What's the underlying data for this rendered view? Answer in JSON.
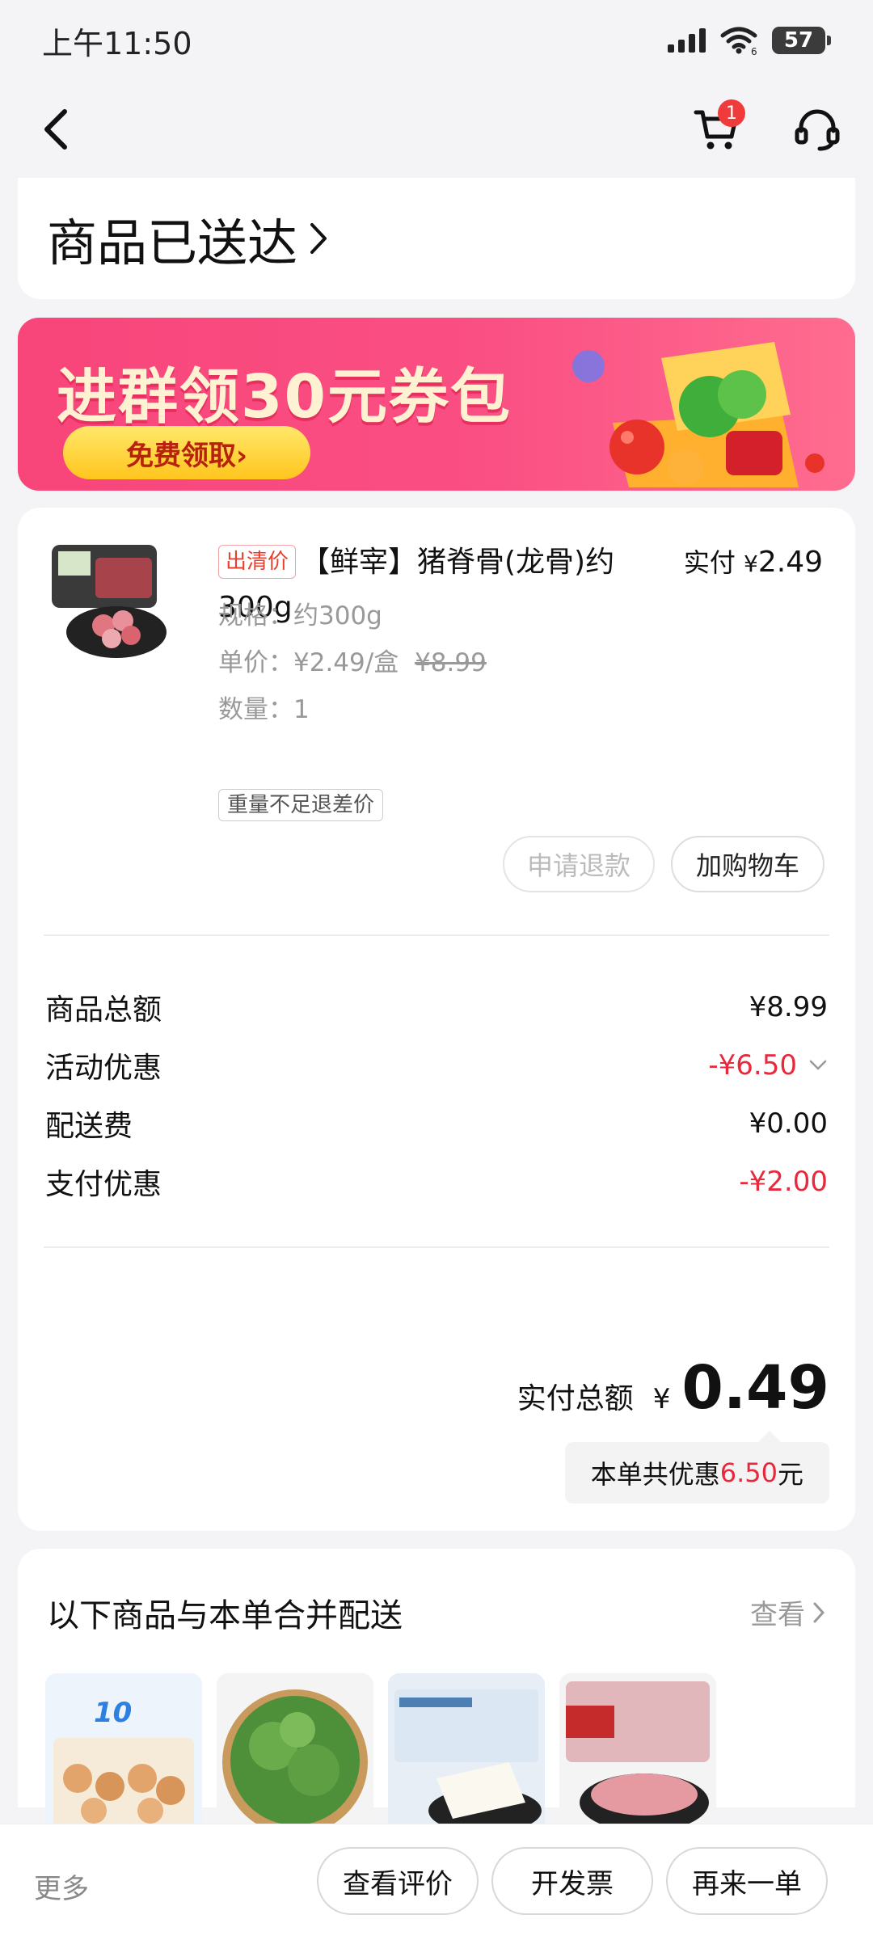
{
  "status_bar": {
    "time": "上午11:50",
    "battery": "57",
    "network_label": "6"
  },
  "nav": {
    "back_icon": "chevron-left-icon",
    "cart_icon": "cart-icon",
    "cart_badge": "1",
    "service_icon": "headset-icon"
  },
  "header": {
    "status_title": "商品已送达"
  },
  "banner": {
    "title": "进群领30元券包",
    "button_label": "免费领取›"
  },
  "product": {
    "tag": "出清价",
    "name": "【鲜宰】猪脊骨(龙骨)约300g",
    "pay_label": "实付",
    "pay_currency": "¥",
    "pay_amount": "2.49",
    "spec": "规格：约300g",
    "unit_price": "单价：¥2.49/盒",
    "original_price": "¥8.99",
    "quantity": "数量：1",
    "weight_tag": "重量不足退差价",
    "refund_button": "申请退款",
    "add_cart_button": "加购物车"
  },
  "fees": [
    {
      "label": "商品总额",
      "value": "¥8.99",
      "negative": false
    },
    {
      "label": "活动优惠",
      "value": "-¥6.50",
      "negative": true,
      "expandable": true
    },
    {
      "label": "配送费",
      "value": "¥0.00",
      "negative": false
    },
    {
      "label": "支付优惠",
      "value": "-¥2.00",
      "negative": true
    }
  ],
  "total": {
    "label": "实付总额",
    "currency": "¥",
    "amount": "0.49",
    "saving_prefix": "本单共优惠",
    "saving_amount": "6.50",
    "saving_suffix": "元"
  },
  "merge": {
    "title": "以下商品与本单合并配送",
    "view_label": "查看",
    "thumb_badge": "10"
  },
  "bottom_bar": {
    "more_label": "更多",
    "review_button": "查看评价",
    "invoice_button": "开发票",
    "reorder_button": "再来一单"
  },
  "colors": {
    "accent_red": "#e8283c",
    "banner_pink": "#f8457a",
    "banner_button_yellow": "#ffc51d"
  }
}
